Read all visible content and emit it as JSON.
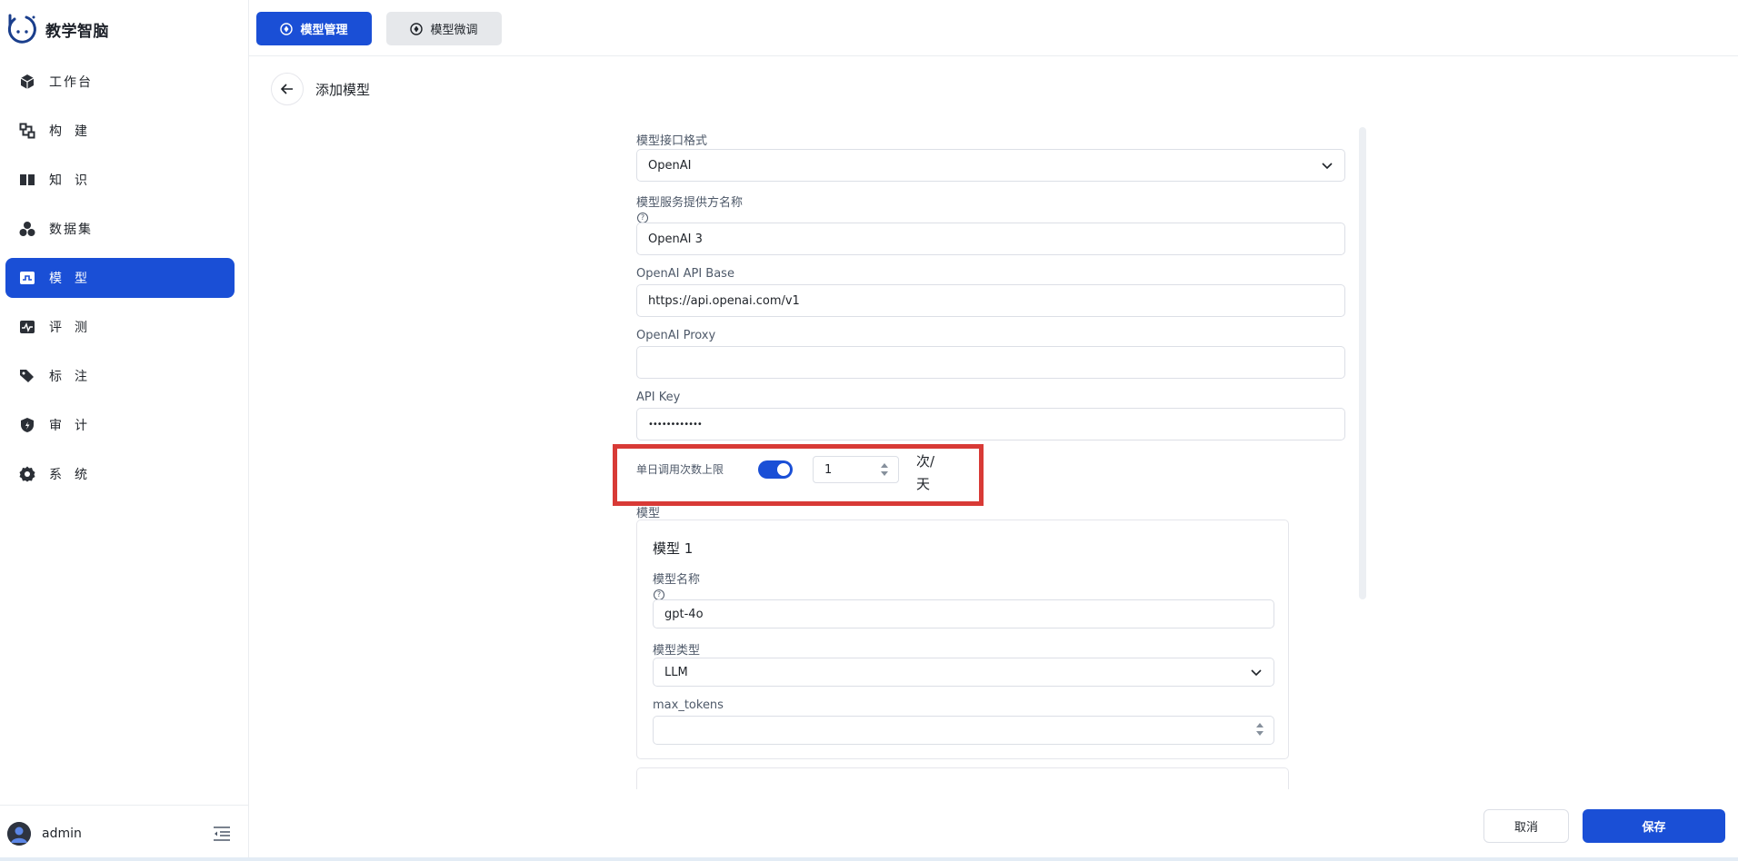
{
  "app": {
    "name": "教学智脑"
  },
  "sidebar": {
    "items": [
      {
        "label": "工作台",
        "icon": "cube-icon",
        "active": false
      },
      {
        "label": "构建",
        "icon": "build-icon",
        "active": false
      },
      {
        "label": "知识",
        "icon": "book-icon",
        "active": false
      },
      {
        "label": "数据集",
        "icon": "dataset-icon",
        "active": false
      },
      {
        "label": "模型",
        "icon": "model-icon",
        "active": true
      },
      {
        "label": "评测",
        "icon": "evaluation-icon",
        "active": false
      },
      {
        "label": "标注",
        "icon": "tag-icon",
        "active": false
      },
      {
        "label": "审计",
        "icon": "shield-icon",
        "active": false
      },
      {
        "label": "系统",
        "icon": "gear-icon",
        "active": false
      }
    ],
    "user": "admin"
  },
  "topbar": {
    "tabs": [
      {
        "label": "模型管理",
        "active": true
      },
      {
        "label": "模型微调",
        "active": false
      }
    ]
  },
  "page": {
    "title": "添加模型"
  },
  "form": {
    "interface_format": {
      "label": "模型接口格式",
      "value": "OpenAI"
    },
    "provider_name": {
      "label": "模型服务提供方名称",
      "value": "OpenAI 3"
    },
    "api_base": {
      "label": "OpenAI API Base",
      "value": "https://api.openai.com/v1"
    },
    "proxy": {
      "label": "OpenAI Proxy",
      "value": ""
    },
    "api_key": {
      "label": "API Key",
      "value": "••••••••••••"
    },
    "daily_limit": {
      "label": "单日调用次数上限",
      "enabled": true,
      "value": "1",
      "unit_line1": "次/",
      "unit_line2": "天"
    },
    "models_label": "模型",
    "model_card": {
      "title": "模型 1",
      "name_label": "模型名称",
      "name_value": "gpt-4o",
      "type_label": "模型类型",
      "type_value": "LLM",
      "max_tokens_label": "max_tokens",
      "max_tokens_value": ""
    }
  },
  "actions": {
    "cancel": "取消",
    "save": "保存"
  },
  "colors": {
    "primary": "#1a4fd6",
    "highlight": "#d83a36",
    "border": "#dcdfe6"
  }
}
